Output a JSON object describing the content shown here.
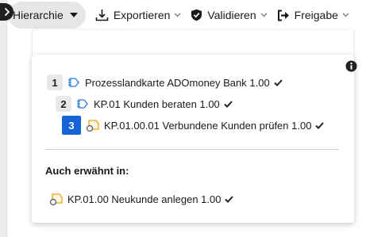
{
  "toolbar": {
    "hierarchy_label": "Hierarchie",
    "export_label": "Exportieren",
    "validate_label": "Validieren",
    "release_label": "Freigabe"
  },
  "hierarchy": {
    "nodes": [
      {
        "level": "1",
        "label": "Prozesslandkarte ADOmoney Bank 1.00",
        "icon": "process-map-icon",
        "current": false
      },
      {
        "level": "2",
        "label": "KP.01 Kunden beraten 1.00",
        "icon": "process-map-icon",
        "current": false
      },
      {
        "level": "3",
        "label": "KP.01.00.01 Verbundene Kunden prüfen 1.00",
        "icon": "process-icon",
        "current": true
      }
    ],
    "also_mentioned_title": "Auch erwähnt in:",
    "also_mentioned": [
      {
        "label": "KP.01.00 Neukunde anlegen 1.00",
        "icon": "process-icon"
      }
    ]
  },
  "colors": {
    "current_level": "#1565d8",
    "process_icon": "#e9a21b",
    "map_icon": "#2f7dd6"
  }
}
